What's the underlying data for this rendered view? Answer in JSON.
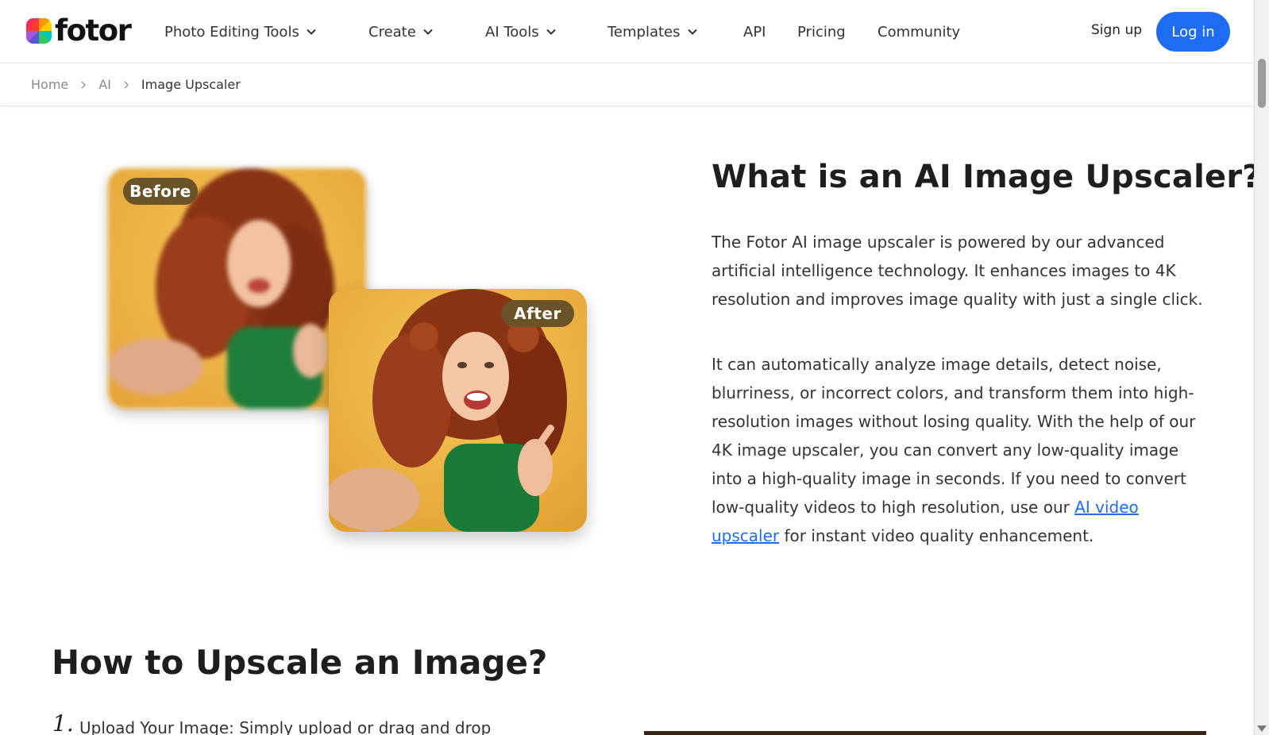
{
  "brand": {
    "name": "fotor",
    "accent": "#1d6cf2"
  },
  "nav": {
    "items": [
      {
        "label": "Photo Editing Tools",
        "dropdown": true
      },
      {
        "label": "Create",
        "dropdown": true
      },
      {
        "label": "AI Tools",
        "dropdown": true
      },
      {
        "label": "Templates",
        "dropdown": true
      },
      {
        "label": "API",
        "dropdown": false
      },
      {
        "label": "Pricing",
        "dropdown": false
      },
      {
        "label": "Community",
        "dropdown": false
      }
    ],
    "signup_label": "Sign up",
    "login_label": "Log in"
  },
  "breadcrumb": {
    "home": "Home",
    "ai": "AI",
    "current": "Image Upscaler"
  },
  "comparison": {
    "before_label": "Before",
    "after_label": "After"
  },
  "article": {
    "title": "What is an AI Image Upscaler?",
    "para1": "The Fotor AI image upscaler is powered by our advanced artificial intelligence technology. It enhances images to 4K resolution and improves image quality with just a single click.",
    "para2_before_link": "It can automatically analyze image details, detect noise, blurriness, or incorrect colors, and transform them into high-resolution images without losing quality. With the help of our 4K image upscaler, you can convert any low-quality image into a high-quality image in seconds. If you need to convert low-quality videos to high resolution, use our ",
    "para2_link": "AI video upscaler",
    "para2_after_link": " for instant video quality enhancement."
  },
  "how_to": {
    "title": "How to Upscale an Image?",
    "step1_num": "1.",
    "step1_text": "Upload Your Image: Simply upload or drag and drop"
  }
}
